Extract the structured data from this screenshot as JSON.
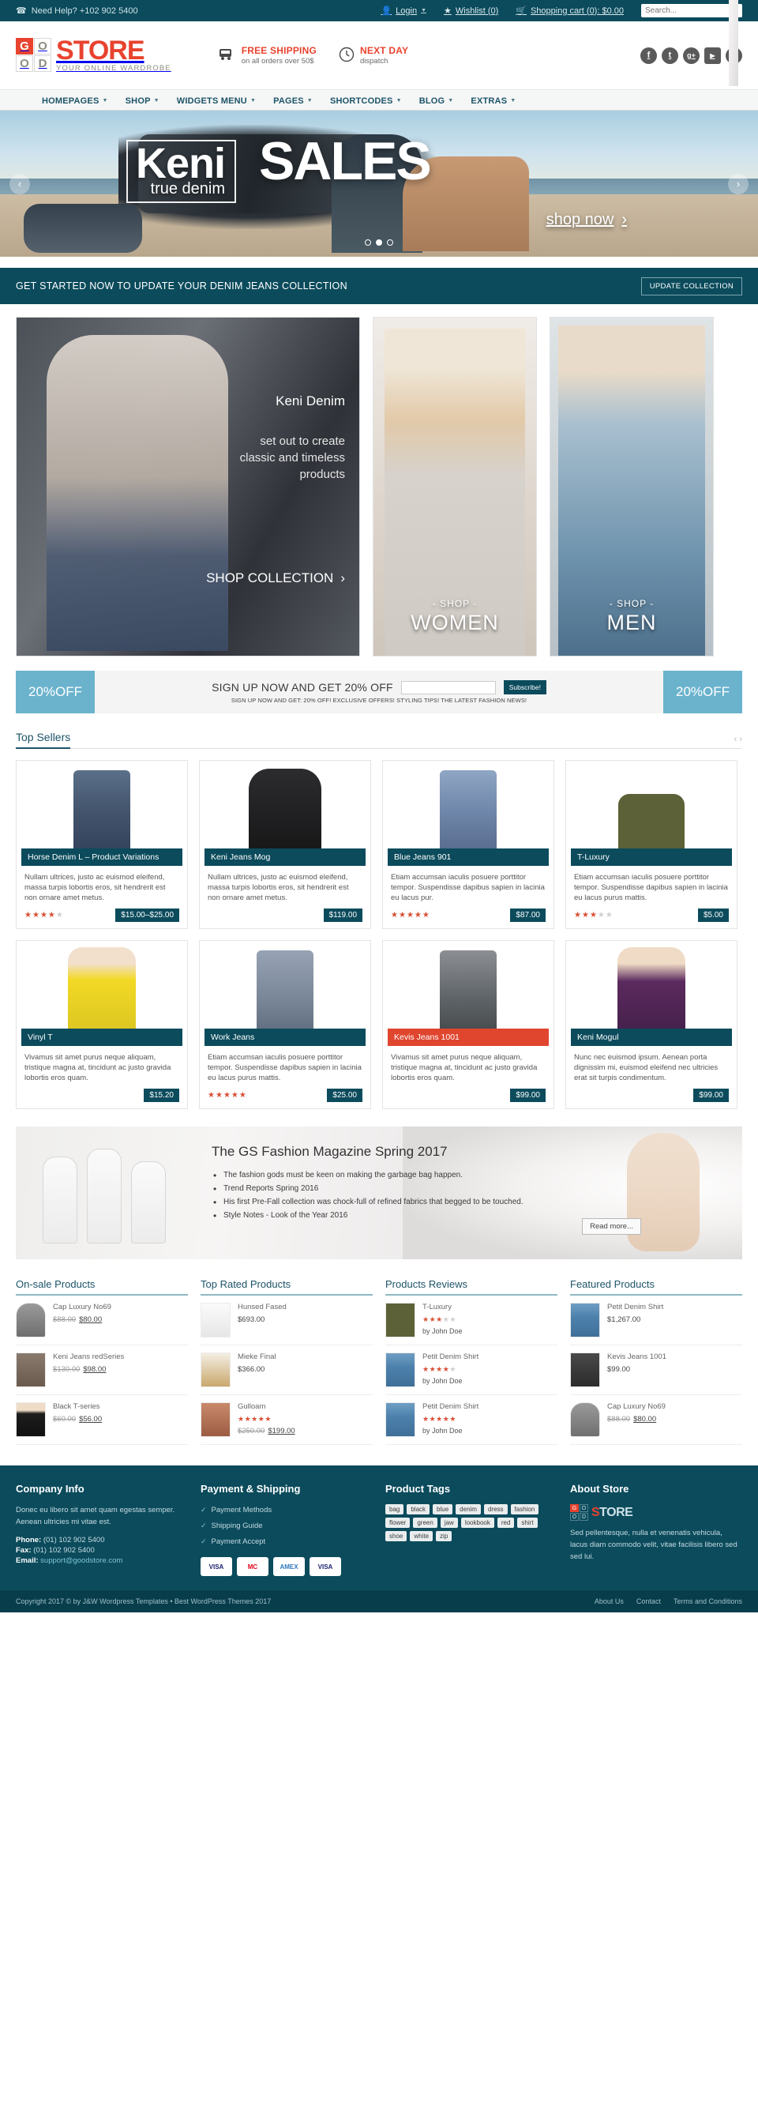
{
  "topbar": {
    "phone_icon": "phone-icon",
    "phone": "Need Help? +102 902 5400",
    "login": "Login",
    "wishlist": "Wishlist (0)",
    "cart": "Shopping cart (0): $0.00",
    "search_placeholder": "Search..."
  },
  "header": {
    "logo": {
      "g": "G",
      "o1": "O",
      "o2": "O",
      "d": "D",
      "store": "STORE",
      "store_accent": "S",
      "tagline": "YOUR ONLINE WARDROBE"
    },
    "promos": [
      {
        "icon": "truck-icon",
        "title": "FREE SHIPPING",
        "sub": "on all orders over 50$"
      },
      {
        "icon": "clock-icon",
        "title": "NEXT DAY",
        "sub": "dispatch"
      }
    ],
    "socials": [
      {
        "name": "facebook-icon",
        "glyph": "f"
      },
      {
        "name": "twitter-icon",
        "glyph": "t"
      },
      {
        "name": "googleplus-icon",
        "glyph": "g+"
      },
      {
        "name": "youtube-icon",
        "glyph": "▶"
      },
      {
        "name": "flickr-icon",
        "glyph": "••"
      }
    ]
  },
  "nav": {
    "items": [
      {
        "label": "HOMEPAGES",
        "caret": "▼"
      },
      {
        "label": "SHOP",
        "caret": "▼"
      },
      {
        "label": "WIDGETS MENU",
        "caret": "▼"
      },
      {
        "label": "PAGES",
        "caret": "▼"
      },
      {
        "label": "SHORTCODES",
        "caret": "▼"
      },
      {
        "label": "BLOG",
        "caret": "▼"
      },
      {
        "label": "EXTRAS",
        "caret": "▼"
      }
    ]
  },
  "hero": {
    "keni": "Keni",
    "true_denim": "true denim",
    "sales": "SALES",
    "shop_now": "shop now",
    "shop_now_arrow": "›",
    "prev": "‹",
    "next": "›",
    "dots": 3,
    "active_dot": 1
  },
  "cta": {
    "text": "GET STARTED NOW TO UPDATE YOUR DENIM JEANS COLLECTION",
    "button": "UPDATE COLLECTION"
  },
  "tiles": {
    "big": {
      "title": "Keni Denim",
      "sub": "set out to create\nclassic and timeless\nproducts",
      "sub_line1": "set out to create",
      "sub_line2": "classic and timeless",
      "sub_line3": "products",
      "link": "SHOP COLLECTION",
      "link_arrow": "›"
    },
    "women": {
      "kicker": "- SHOP -",
      "label": "WOMEN"
    },
    "men": {
      "kicker": "- SHOP -",
      "label": "MEN"
    }
  },
  "newsletter": {
    "badge_left": "20%OFF",
    "badge_right": "20%OFF",
    "headline": "SIGN UP NOW AND GET 20% OFF",
    "input_value": "",
    "input_placeholder": "",
    "button": "Subscribe!",
    "subtext": "SIGN UP NOW AND GET: 20% OFF! EXCLUSIVE OFFERS! STYLING TIPS! THE LATEST FASHION NEWS!"
  },
  "top_sellers": {
    "title": "Top Sellers",
    "prev": "‹",
    "next": "›",
    "products": [
      {
        "name": "Horse Denim L – Product Variations",
        "desc": "Nullam ultrices, justo ac euismod eleifend, massa turpis lobortis eros, sit hendrerit est non ornare  amet metus.",
        "rating": 4,
        "price": "$15.00–$25.00",
        "thumb": "jeans-dark",
        "name_color": "#0b4b5c"
      },
      {
        "name": "Keni Jeans Mog",
        "desc": "Nullam ultrices, justo ac euismod eleifend, massa turpis lobortis eros, sit hendrerit est non ornare  amet metus.",
        "rating": 0,
        "price": "$119.00",
        "thumb": "hoodie",
        "name_color": "#0b4b5c"
      },
      {
        "name": "Blue Jeans 901",
        "desc": "Etiam accumsan iaculis posuere porttitor tempor. Suspendisse dapibus sapien in lacinia eu lacus pur.",
        "rating": 4.5,
        "price": "$87.00",
        "thumb": "jeans-light",
        "name_color": "#0b4b5c"
      },
      {
        "name": "T-Luxury",
        "desc": "Etiam accumsan iaculis posuere porttitor tempor. Suspendisse dapibus sapien in lacinia eu lacus purus mattis.",
        "rating": 3,
        "price": "$5.00",
        "thumb": "tee-green",
        "name_color": "#0b4b5c"
      },
      {
        "name": "Vinyl T",
        "desc": "Vivamus sit amet purus neque aliquam, tristique magna at, tincidunt ac justo gravida lobortis eros quam.",
        "rating": 0,
        "price": "$15.20",
        "thumb": "person-yellow",
        "name_color": "#0b4b5c"
      },
      {
        "name": "Work Jeans",
        "desc": "Etiam accumsan iaculis posuere porttitor tempor. Suspendisse dapibus sapien in lacinia eu lacus purus mattis.",
        "rating": 5,
        "price": "$25.00",
        "thumb": "jeans-work",
        "name_color": "#0b4b5c"
      },
      {
        "name": "Kevis Jeans 1001",
        "desc": "Vivamus sit amet purus neque aliquam, tristique magna at, tincidunt ac justo gravida lobortis eros quam.",
        "rating": 0,
        "price": "$99.00",
        "thumb": "jeans-gray",
        "name_color": "#e0452e"
      },
      {
        "name": "Keni Mogul",
        "desc": "Nunc nec euismod ipsum. Aenean porta dignissim mi, euismod eleifend nec ultricies erat sit turpis condimentum.",
        "rating": 0,
        "price": "$99.00",
        "thumb": "person-purple",
        "name_color": "#0b4b5c"
      }
    ]
  },
  "magazine": {
    "title": "The GS Fashion Magazine Spring 2017",
    "bullets": [
      "The fashion gods must be keen on making the garbage bag happen.",
      "Trend Reports Spring 2016",
      "His first Pre-Fall collection was chock-full of refined fabrics that begged to be touched.",
      "Style Notes - Look of the Year 2016"
    ],
    "read_more": "Read more..."
  },
  "widgets": [
    {
      "title": "On-sale Products",
      "items": [
        {
          "name": "Cap Luxury No69",
          "old_price": "$88.00",
          "price": "$80.00",
          "thumb": "cap"
        },
        {
          "name": "Keni Jeans redSeries",
          "old_price": "$130.00",
          "price": "$98.00",
          "thumb": "jeansred"
        },
        {
          "name": "Black T-series",
          "old_price": "$60.00",
          "price": "$56.00",
          "thumb": "blackt"
        }
      ]
    },
    {
      "title": "Top Rated Products",
      "items": [
        {
          "name": "Hunsed Fased",
          "price": "$693.00",
          "thumb": "heel"
        },
        {
          "name": "Mieke Final",
          "price": "$366.00",
          "thumb": "flat"
        },
        {
          "name": "Gulloam",
          "rating": 5,
          "old_price": "$250.00",
          "price": "$199.00",
          "thumb": "bag"
        }
      ]
    },
    {
      "title": "Products Reviews",
      "items": [
        {
          "name": "T-Luxury",
          "rating": 3,
          "by": "by John Doe",
          "thumb": "greent"
        },
        {
          "name": "Petit Denim Shirt",
          "rating": 4,
          "by": "by John Doe",
          "thumb": "denimgirl"
        },
        {
          "name": "Petit Denim Shirt",
          "rating": 5,
          "by": "by John Doe",
          "thumb": "denimgirl"
        }
      ]
    },
    {
      "title": "Featured Products",
      "items": [
        {
          "name": "Petit Denim Shirt",
          "price": "$1,267.00",
          "thumb": "denimgirl"
        },
        {
          "name": "Kevis Jeans 1001",
          "price": "$99.00",
          "thumb": "blkjeans"
        },
        {
          "name": "Cap Luxury No69",
          "old_price": "$88.00",
          "price": "$80.00",
          "thumb": "cap"
        }
      ]
    }
  ],
  "footer": {
    "company": {
      "title": "Company Info",
      "text": "Donec eu libero sit amet quam egestas semper. Aenean ultricies mi vitae est.",
      "phone_label": "Phone:",
      "phone": "(01) 102 902 5400",
      "fax_label": "Fax:",
      "fax": "(01) 102 902 5400",
      "email_label": "Email:",
      "email": "support@goodstore.com"
    },
    "payment": {
      "title": "Payment & Shipping",
      "items": [
        "Payment Methods",
        "Shipping Guide",
        "Payment Accept"
      ],
      "cards": [
        "VISA",
        "MC",
        "AMEX",
        "VISA"
      ]
    },
    "tags": {
      "title": "Product Tags",
      "items": [
        "bag",
        "black",
        "blue",
        "denim",
        "dress",
        "fashion",
        "flower",
        "green",
        "jaw",
        "lookbook",
        "red",
        "shirt",
        "shoe",
        "white",
        "zip"
      ]
    },
    "about": {
      "title": "About Store",
      "logo_text": "STORE",
      "logo_accent": "S",
      "text": "Sed pellentesque, nulla et venenatis vehicula, lacus diam commodo velit, vitae facilisis libero sed sed lui."
    },
    "bottom": {
      "copyright": "Copyright 2017 © by J&W Wordpress Templates • Best WordPress Themes 2017",
      "links": [
        "About Us",
        "Contact",
        "Terms and Conditions"
      ]
    }
  }
}
